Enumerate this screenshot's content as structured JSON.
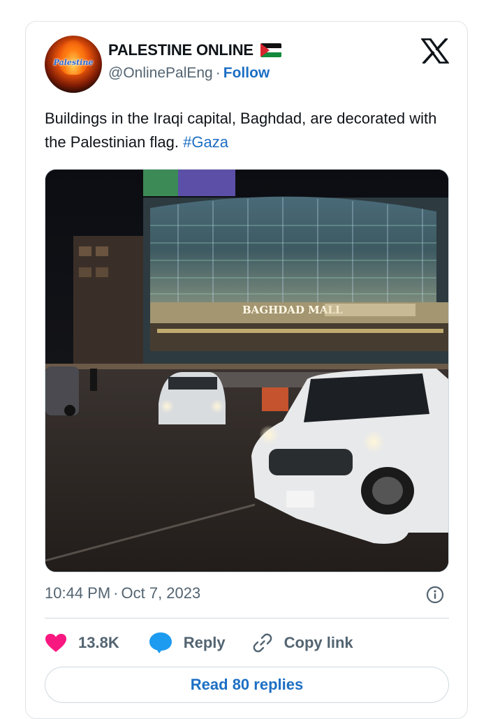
{
  "author": {
    "display_name": "PALESTINE ONLINE",
    "handle": "@OnlinePalEng",
    "separator": "·",
    "follow_label": "Follow",
    "avatar_text": "Palestine"
  },
  "tweet": {
    "text": "Buildings in the Iraqi capital, Baghdad, are decorated with the Palestinian flag.",
    "hashtag": "#Gaza"
  },
  "media": {
    "sign_text": "BAGHDAD MALL"
  },
  "meta": {
    "time": "10:44 PM",
    "separator": "·",
    "date": "Oct 7, 2023"
  },
  "actions": {
    "like_count": "13.8K",
    "reply_label": "Reply",
    "copy_label": "Copy link"
  },
  "read_replies_label": "Read 80 replies",
  "icons": {
    "brand": "x-logo-icon",
    "like": "heart-icon",
    "reply": "speech-bubble-icon",
    "copy": "link-icon",
    "info": "info-icon",
    "flag": "palestine-flag-icon"
  },
  "colors": {
    "link": "#1d6fc4",
    "muted": "#536471",
    "heart": "#f91880",
    "reply": "#1d9bf0"
  }
}
